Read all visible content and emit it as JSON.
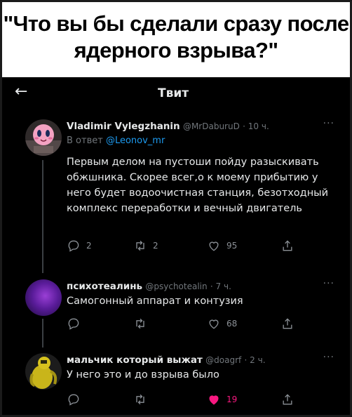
{
  "meme_caption": "\"Что вы бы сделали сразу после ядерного взрыва?\"",
  "header": {
    "title": "Твит",
    "back_icon": "arrow-left-icon"
  },
  "tweets": [
    {
      "name": "Vladimir Vylegzhanin",
      "handle": "@MrDaburuD",
      "time": "· 10 ч.",
      "reply_prefix": "В ответ ",
      "reply_handle": "@Leonov_mr",
      "text": "Первым делом на пустоши пойду разыскивать обжшника. Скорее всег,о к моему прибытию у него будет водоочистная станция, безотходный комплекс переработки и вечный двигатель",
      "replies": "2",
      "retweets": "2",
      "likes": "95"
    },
    {
      "name": "психотеалинь",
      "handle": "@psychotealin",
      "time": "· 7 ч.",
      "text": "Самогонный аппарат и контузия",
      "replies": "",
      "retweets": "",
      "likes": "68"
    },
    {
      "name": "мальчик который выжат",
      "handle": "@doagrf",
      "time": "· 2 ч.",
      "text": "У него это и до взрыва было",
      "replies": "",
      "retweets": "",
      "likes": "19",
      "liked": true
    }
  ],
  "colors": {
    "background": "#000000",
    "text": "#e7e9ea",
    "muted": "#71767b",
    "link": "#1d9bf0",
    "like": "#f91880"
  }
}
